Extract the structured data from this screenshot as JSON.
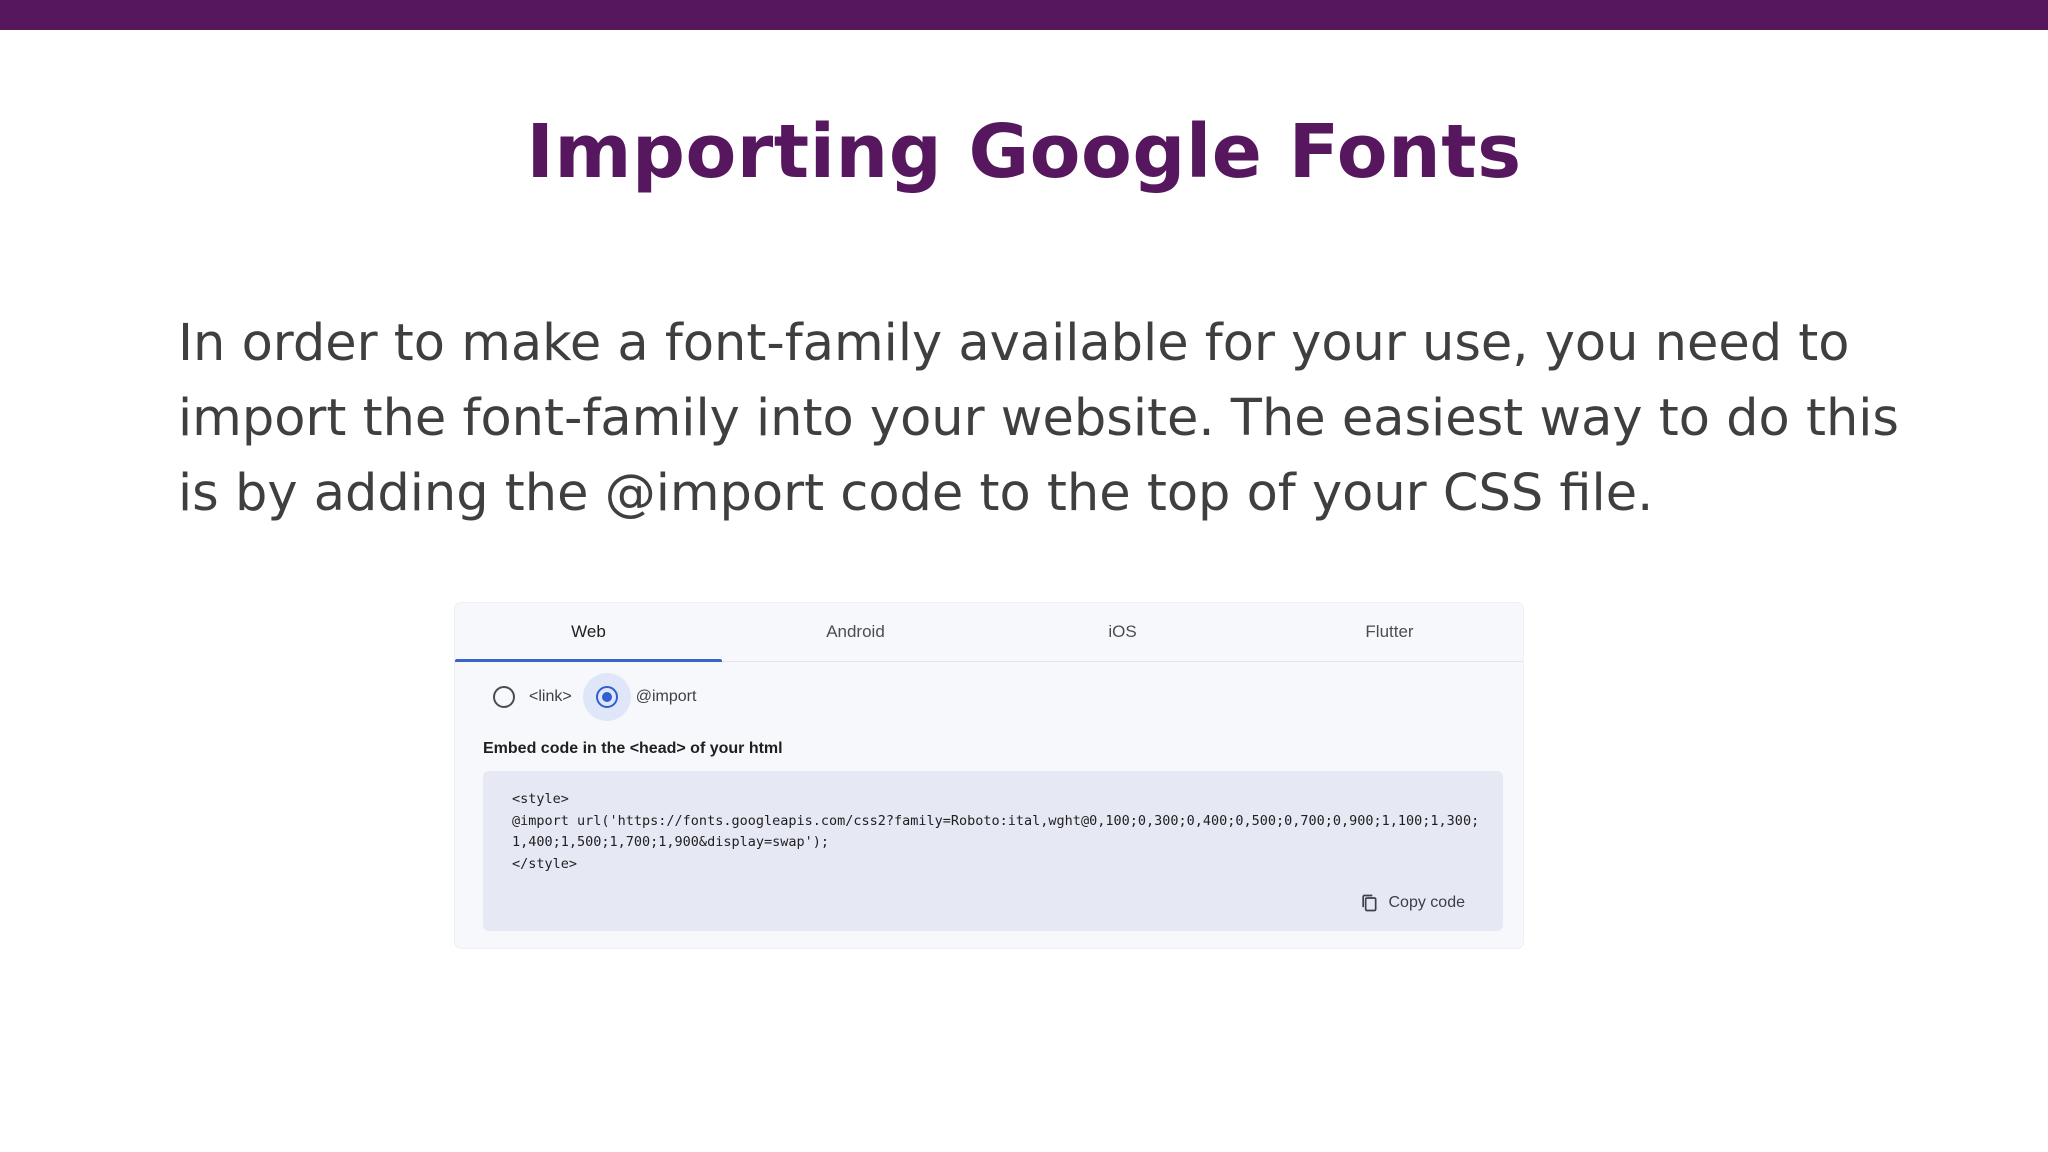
{
  "slide": {
    "title": "Importing Google Fonts",
    "body": "In order to make a font-family available for your use, you need to import the font-family into your website. The easiest way to do this is by adding the @import code to the top of your CSS file."
  },
  "embed_panel": {
    "tabs": [
      {
        "label": "Web",
        "active": true
      },
      {
        "label": "Android",
        "active": false
      },
      {
        "label": "iOS",
        "active": false
      },
      {
        "label": "Flutter",
        "active": false
      }
    ],
    "options": {
      "link_label": "<link>",
      "import_label": "@import",
      "selected": "@import"
    },
    "embed_label": "Embed code in the <head> of your html",
    "code_lines": {
      "line1": "<style>",
      "line2": "@import url('https://fonts.googleapis.com/css2?family=Roboto:ital,wght@0,100;0,300;0,400;0,500;0,700;0,900;1,100;1,300;1,400;1,500;1,700;1,900&display=swap');",
      "line3": "</style>"
    },
    "copy_label": "Copy code"
  },
  "colors": {
    "brand_purple": "#56175f",
    "body_text": "#3f3f3f",
    "tab_accent": "#3a64c8",
    "code_background": "#e6e9f4"
  },
  "icons": {
    "copy": "copy-icon"
  }
}
